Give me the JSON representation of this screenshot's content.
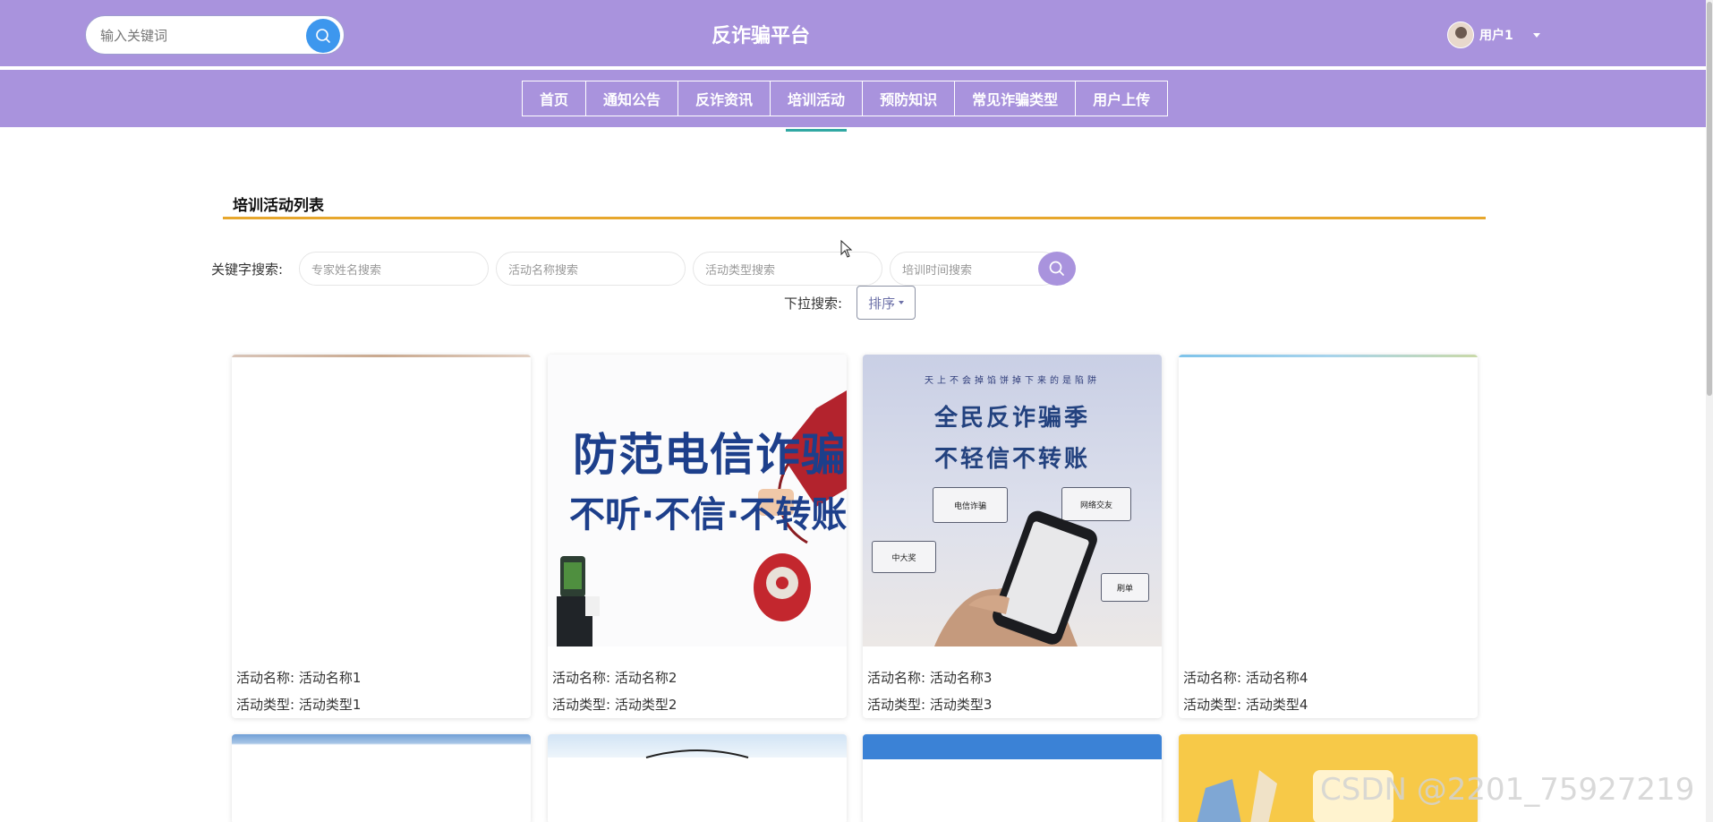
{
  "header": {
    "search_placeholder": "输入关键词",
    "title": "反诈骗平台",
    "user_name": "用户1"
  },
  "nav": {
    "items": [
      "首页",
      "通知公告",
      "反诈资讯",
      "培训活动",
      "预防知识",
      "常见诈骗类型",
      "用户上传"
    ],
    "active": "培训活动"
  },
  "section": {
    "title": "培训活动列表"
  },
  "filters": {
    "label": "关键字搜索:",
    "expert_placeholder": "专家姓名搜索",
    "name_placeholder": "活动名称搜索",
    "type_placeholder": "活动类型搜索",
    "time_placeholder": "培训时间搜索",
    "dropdown_label": "下拉搜索:",
    "sort_label": "排序"
  },
  "cards": [
    {
      "name_label": "活动名称: 活动名称1",
      "type_label": "活动类型: 活动类型1"
    },
    {
      "name_label": "活动名称: 活动名称2",
      "type_label": "活动类型: 活动类型2",
      "img_text_1": "防范电信诈骗",
      "img_text_2": "不听·不信·不转账"
    },
    {
      "name_label": "活动名称: 活动名称3",
      "type_label": "活动类型: 活动类型3",
      "img_text_top": "天上不会掉馅饼掉下来的是陷阱",
      "img_text_1": "全民反诈骗季",
      "img_text_2": "不轻信不转账",
      "bubble_1": "电信诈骗",
      "bubble_2": "网络交友",
      "bubble_3": "中大奖",
      "bubble_4": "刷单"
    },
    {
      "name_label": "活动名称: 活动名称4",
      "type_label": "活动类型: 活动类型4"
    }
  ],
  "watermark": "CSDN @2201_75927219",
  "colors": {
    "header_bg": "#a993dd",
    "accent_line": "#e7a72d",
    "active_indicator": "#31a8a3",
    "search_button": "#3d97ee"
  }
}
